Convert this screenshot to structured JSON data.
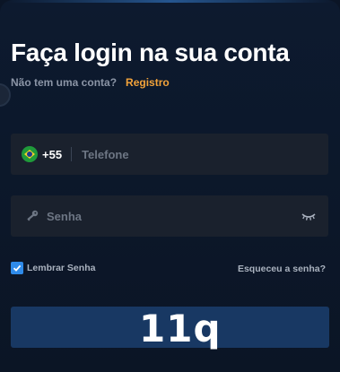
{
  "login": {
    "title": "Faça login na sua conta",
    "no_account_text": "Não tem uma conta?",
    "register_link": "Registro",
    "phone": {
      "country_flag": "brazil-flag-icon",
      "dial_code": "+55",
      "placeholder": "Telefone",
      "value": ""
    },
    "password": {
      "placeholder": "Senha",
      "value": ""
    },
    "remember_label": "Lembrar Senha",
    "remember_checked": true,
    "forgot_link": "Esqueceu a senha?",
    "login_button_label": ""
  },
  "overlay": {
    "text": "11q"
  },
  "colors": {
    "background": "#0b1526",
    "field": "#1a212d",
    "accent_link": "#f2a33a",
    "checkbox": "#2f8bea",
    "button": "#183863"
  }
}
